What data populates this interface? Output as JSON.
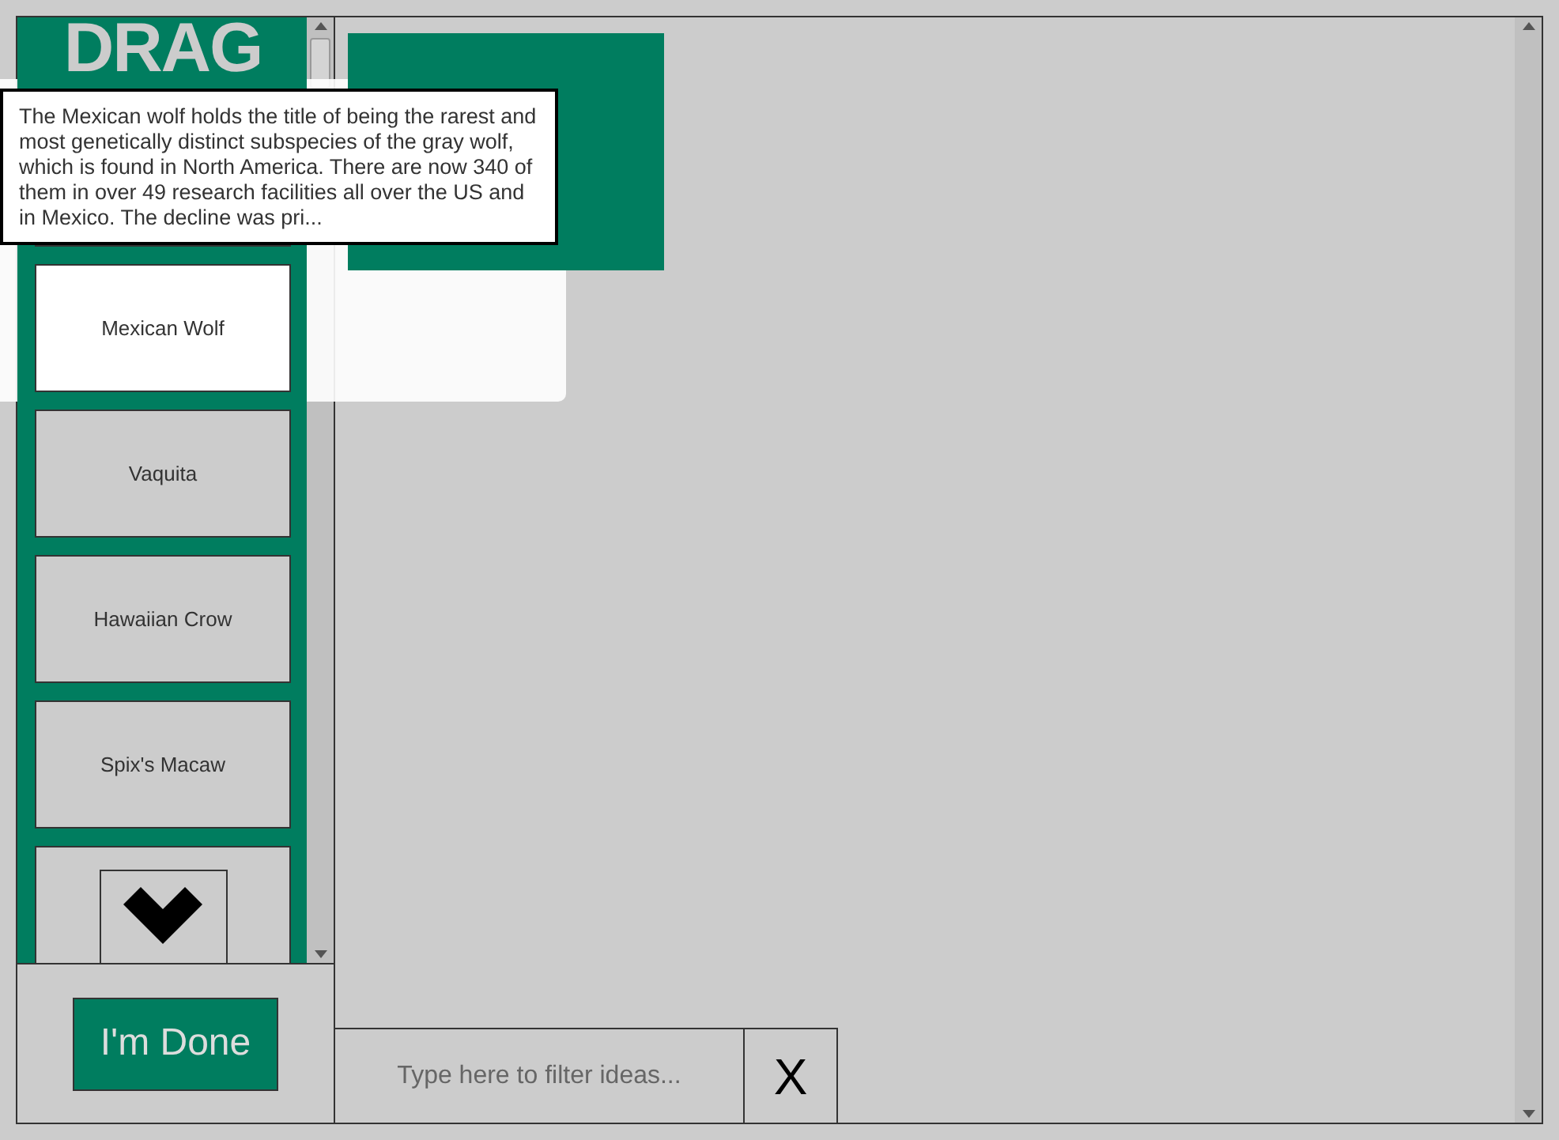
{
  "drag_panel": {
    "title": "DRAG",
    "tooltip": "The Mexican wolf holds the title of being the rarest and most genetically distinct subspecies of the gray wolf, which is found in North America. There are now 340 of them in over 49 research facilities all over the US and in Mexico. The decline was pri...",
    "cards": [
      {
        "label": "Mexican Wolf",
        "selected": true
      },
      {
        "label": "Vaquita",
        "selected": false
      },
      {
        "label": "Hawaiian Crow",
        "selected": false
      },
      {
        "label": "Spix's Macaw",
        "selected": false
      }
    ]
  },
  "done_button": "I'm Done",
  "filter": {
    "placeholder": "Type here to filter ideas..."
  },
  "clear_button": "X"
}
